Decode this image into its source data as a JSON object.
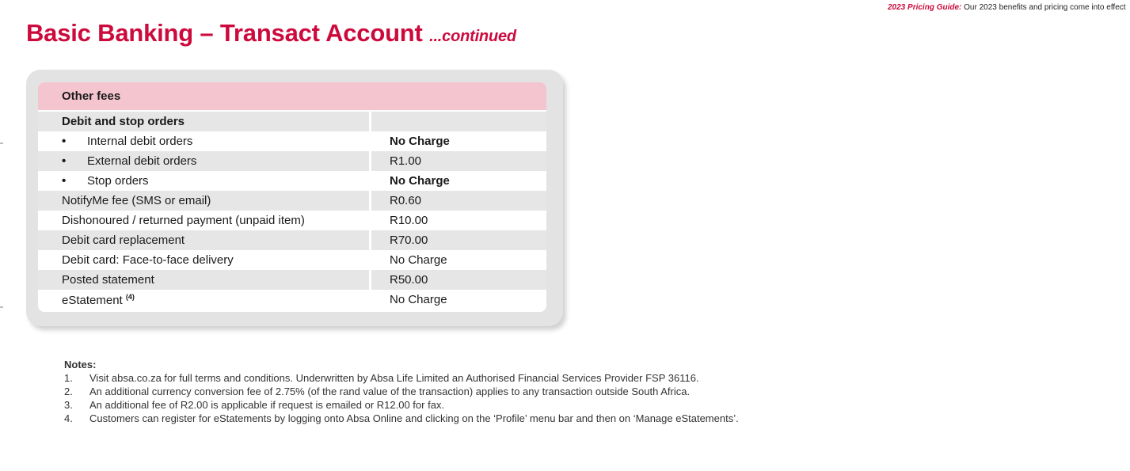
{
  "header_note": {
    "label": "2023 Pricing Guide:",
    "text": "Our 2023 benefits and pricing come into effect"
  },
  "title": {
    "main": "Basic Banking – Transact Account",
    "continued": "...continued"
  },
  "table": {
    "heading": "Other fees",
    "rows": [
      {
        "label": "Debit and stop orders",
        "value": "",
        "bullet": "",
        "bold_value": false,
        "shaded": true
      },
      {
        "label": "Internal debit orders",
        "value": "No Charge",
        "bullet": "•",
        "bold_value": true,
        "shaded": false
      },
      {
        "label": "External debit orders",
        "value": "R1.00",
        "bullet": "•",
        "bold_value": false,
        "shaded": true
      },
      {
        "label": "Stop orders",
        "value": "No Charge",
        "bullet": "•",
        "bold_value": true,
        "shaded": false
      },
      {
        "label": "NotifyMe fee (SMS or email)",
        "value": "R0.60",
        "bullet": "",
        "bold_value": false,
        "shaded": true
      },
      {
        "label": "Dishonoured / returned payment (unpaid item)",
        "value": "R10.00",
        "bullet": "",
        "bold_value": false,
        "shaded": false
      },
      {
        "label": "Debit card replacement",
        "value": "R70.00",
        "bullet": "",
        "bold_value": false,
        "shaded": true
      },
      {
        "label": "Debit card: Face-to-face delivery",
        "value": "No Charge",
        "bullet": "",
        "bold_value": false,
        "shaded": false
      },
      {
        "label": "Posted statement",
        "value": "R50.00",
        "bullet": "",
        "bold_value": false,
        "shaded": true
      },
      {
        "label": "eStatement",
        "sup": "(4)",
        "value": "No Charge",
        "bullet": "",
        "bold_value": false,
        "shaded": false
      }
    ]
  },
  "notes": {
    "title": "Notes:",
    "items": [
      {
        "num": "1.",
        "text": "Visit absa.co.za for full terms and conditions. Underwritten by Absa Life Limited an Authorised Financial Services Provider FSP 36116."
      },
      {
        "num": "2.",
        "text": "An additional currency conversion fee of 2.75% (of the rand value of the transaction) applies to any transaction outside South Africa."
      },
      {
        "num": "3.",
        "text": "An additional fee of R2.00 is applicable if request is emailed or R12.00 for fax."
      },
      {
        "num": "4.",
        "text": "Customers can register for eStatements by logging onto Absa Online and clicking on the ‘Profile’ menu bar and then on ‘Manage eStatements’."
      }
    ]
  },
  "colors": {
    "brand_red": "#cc0a3c",
    "header_pink": "#f5c5cf",
    "row_shade": "#e6e6e6",
    "card_gray": "#e3e3e3"
  }
}
